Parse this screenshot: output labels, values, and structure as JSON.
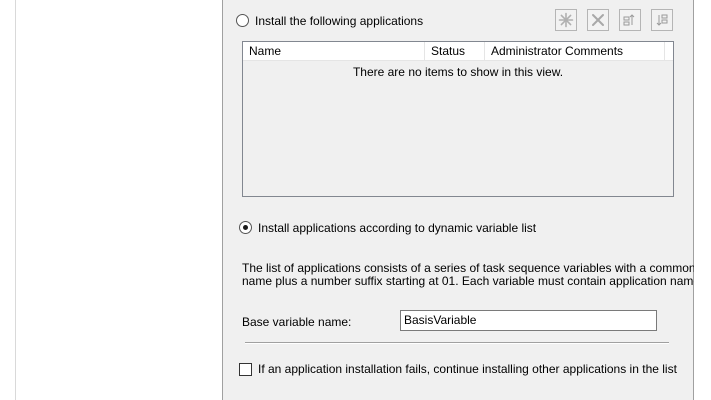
{
  "options": {
    "install_following_label": "Install the following applications",
    "install_following_selected": false,
    "install_dynamic_label": "Install applications according to dynamic variable list",
    "install_dynamic_selected": true
  },
  "toolbar": {
    "icons": [
      "new-icon",
      "delete-icon",
      "move-up-icon",
      "move-down-icon"
    ]
  },
  "app_list": {
    "columns": [
      "Name",
      "Status",
      "Administrator Comments"
    ],
    "rows": [],
    "empty_message": "There are no items to show in this view."
  },
  "dynamic": {
    "description_line1": "The list of applications consists of a series of task sequence variables with a common base",
    "description_line2": "name plus a number suffix starting at 01.  Each variable must contain application name.",
    "base_variable_label": "Base variable name:",
    "base_variable_value": "BasisVariable"
  },
  "continue_on_error": {
    "label": "If an application installation fails, continue installing other applications in the list",
    "checked": false
  }
}
